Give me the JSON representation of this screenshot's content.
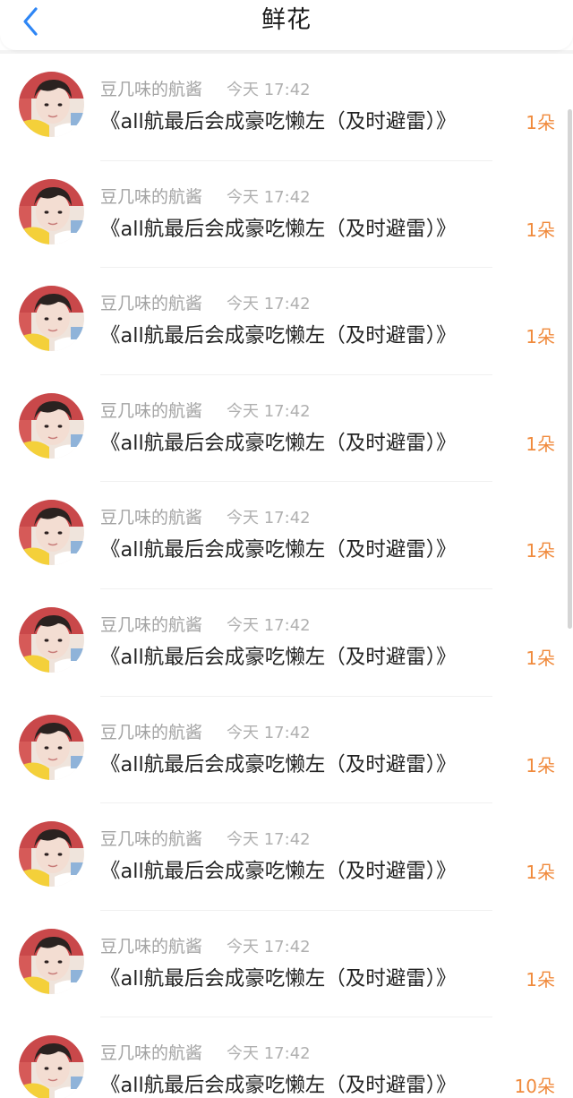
{
  "header": {
    "title": "鲜花",
    "back_icon": "chevron-left-icon",
    "accent_color": "#2e86f5"
  },
  "items": [
    {
      "name": "豆几味的航酱",
      "time": "今天 17:42",
      "title": "《all航最后会成豪吃懒左（及时避雷）》",
      "count": "1朵"
    },
    {
      "name": "豆几味的航酱",
      "time": "今天 17:42",
      "title": "《all航最后会成豪吃懒左（及时避雷）》",
      "count": "1朵"
    },
    {
      "name": "豆几味的航酱",
      "time": "今天 17:42",
      "title": "《all航最后会成豪吃懒左（及时避雷）》",
      "count": "1朵"
    },
    {
      "name": "豆几味的航酱",
      "time": "今天 17:42",
      "title": "《all航最后会成豪吃懒左（及时避雷）》",
      "count": "1朵"
    },
    {
      "name": "豆几味的航酱",
      "time": "今天 17:42",
      "title": "《all航最后会成豪吃懒左（及时避雷）》",
      "count": "1朵"
    },
    {
      "name": "豆几味的航酱",
      "time": "今天 17:42",
      "title": "《all航最后会成豪吃懒左（及时避雷）》",
      "count": "1朵"
    },
    {
      "name": "豆几味的航酱",
      "time": "今天 17:42",
      "title": "《all航最后会成豪吃懒左（及时避雷）》",
      "count": "1朵"
    },
    {
      "name": "豆几味的航酱",
      "time": "今天 17:42",
      "title": "《all航最后会成豪吃懒左（及时避雷）》",
      "count": "1朵"
    },
    {
      "name": "豆几味的航酱",
      "time": "今天 17:42",
      "title": "《all航最后会成豪吃懒左（及时避雷）》",
      "count": "1朵"
    },
    {
      "name": "豆几味的航酱",
      "time": "今天 17:42",
      "title": "《all航最后会成豪吃懒左（及时避雷）》",
      "count": "10朵"
    }
  ],
  "colors": {
    "count": "#f08a3c",
    "meta": "#a3a3a3",
    "title": "#222222"
  }
}
